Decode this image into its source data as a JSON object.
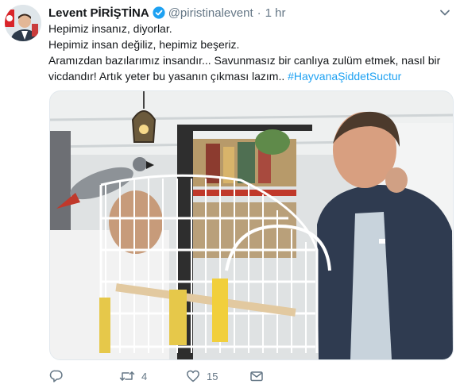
{
  "tweet": {
    "author_name": "Levent PİRİŞTİNA",
    "handle": "@piristinalevent",
    "separator": "·",
    "time": "1 hr",
    "lines": [
      "Hepimiz insanız, diyorlar.",
      "Hepimiz insan değiliz, hepimiz beşeriz.",
      "Aramızdan bazılarımız insandır... Savunmasız bir canlıya zulüm etmek, nasıl bir",
      "vicdandır! Artık yeter bu yasanın çıkması lazım.. "
    ],
    "hashtag": "#HayvanaŞiddetSuctur"
  },
  "icons": {
    "verified": "verified-badge-icon",
    "caret": "chevron-down-icon",
    "reply": "reply-icon",
    "retweet": "retweet-icon",
    "like": "heart-icon",
    "dm": "envelope-icon"
  },
  "actions": {
    "reply_count": "",
    "retweet_count": "4",
    "like_count": "15"
  },
  "colors": {
    "accent": "#1da1f2",
    "muted": "#657786",
    "hashtag": "#1da1f2"
  }
}
